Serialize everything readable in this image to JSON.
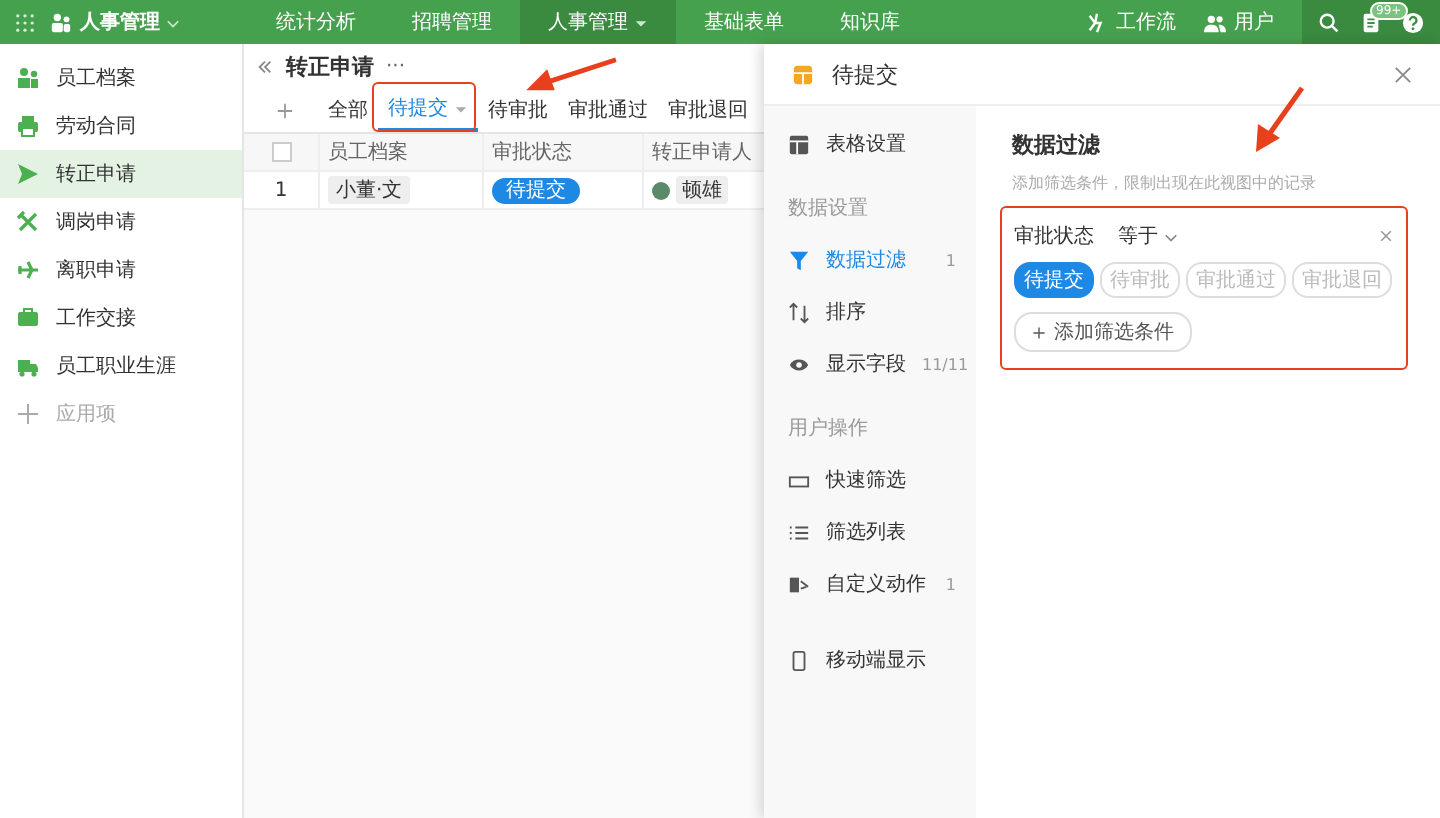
{
  "app": {
    "title": "人事管理"
  },
  "nav": [
    {
      "label": "统计分析",
      "selected": false
    },
    {
      "label": "招聘管理",
      "selected": false
    },
    {
      "label": "人事管理",
      "selected": true
    },
    {
      "label": "基础表单",
      "selected": false
    },
    {
      "label": "知识库",
      "selected": false
    }
  ],
  "toolbar": [
    {
      "kind": "flow",
      "label": "工作流"
    },
    {
      "kind": "users",
      "label": "用户"
    }
  ],
  "notification_badge": "99+",
  "sidebar": {
    "items": [
      {
        "label": "员工档案",
        "selected": false
      },
      {
        "label": "劳动合同",
        "selected": false
      },
      {
        "label": "转正申请",
        "selected": true
      },
      {
        "label": "调岗申请",
        "selected": false
      },
      {
        "label": "离职申请",
        "selected": false
      },
      {
        "label": "工作交接",
        "selected": false
      },
      {
        "label": "员工职业生涯",
        "selected": false
      }
    ],
    "add_label": "应用项"
  },
  "page": {
    "title": "转正申请",
    "more": "···"
  },
  "view_tabs": [
    {
      "label": "全部",
      "selected": false
    },
    {
      "label": "待提交",
      "selected": true
    },
    {
      "label": "待审批",
      "selected": false
    },
    {
      "label": "审批通过",
      "selected": false
    },
    {
      "label": "审批退回",
      "selected": false
    }
  ],
  "table": {
    "select_all": {
      "checked": false
    },
    "columns": [
      "员工档案",
      "审批状态",
      "转正申请人"
    ],
    "rows": [
      {
        "index": "1",
        "employee": "小董·文",
        "status": "待提交",
        "applicant": "顿雄"
      }
    ]
  },
  "drawer": {
    "title": "待提交",
    "menu": [
      {
        "kind": "item",
        "label": "表格设置",
        "selected": false
      },
      {
        "kind": "section",
        "label": "数据设置"
      },
      {
        "kind": "item",
        "label": "数据过滤",
        "selected": true,
        "count": "1"
      },
      {
        "kind": "item",
        "label": "排序",
        "selected": false
      },
      {
        "kind": "item",
        "label": "显示字段",
        "selected": false,
        "count": "11/11"
      },
      {
        "kind": "section",
        "label": "用户操作"
      },
      {
        "kind": "item",
        "label": "快速筛选",
        "selected": false
      },
      {
        "kind": "item",
        "label": "筛选列表",
        "selected": false
      },
      {
        "kind": "item",
        "label": "自定义动作",
        "selected": false,
        "count": "1"
      },
      {
        "kind": "gap"
      },
      {
        "kind": "item",
        "label": "移动端显示",
        "selected": false
      }
    ],
    "filter": {
      "title": "数据过滤",
      "description": "添加筛选条件，限制出现在此视图中的记录",
      "field": "审批状态",
      "operator": "等于",
      "options": [
        {
          "label": "待提交",
          "selected": true
        },
        {
          "label": "待审批",
          "selected": false
        },
        {
          "label": "审批通过",
          "selected": false
        },
        {
          "label": "审批退回",
          "selected": false
        }
      ],
      "add_button": "添加筛选条件"
    }
  }
}
